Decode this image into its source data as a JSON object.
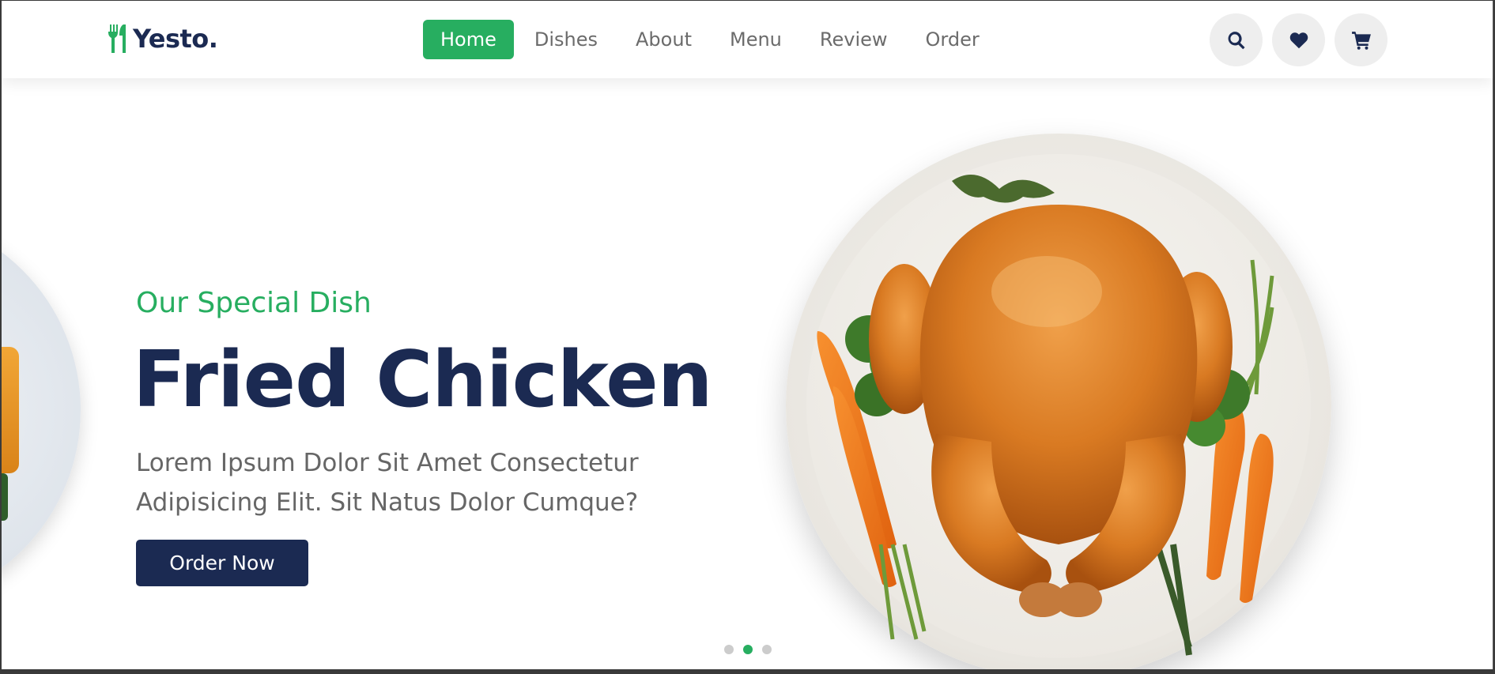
{
  "brand": {
    "name": "Yesto.",
    "accent_color": "#27ae60",
    "dark_color": "#1b2a52"
  },
  "nav": {
    "items": [
      {
        "label": "Home",
        "active": true
      },
      {
        "label": "Dishes",
        "active": false
      },
      {
        "label": "About",
        "active": false
      },
      {
        "label": "Menu",
        "active": false
      },
      {
        "label": "Review",
        "active": false
      },
      {
        "label": "Order",
        "active": false
      }
    ]
  },
  "header_icons": [
    "search-icon",
    "heart-icon",
    "cart-icon"
  ],
  "hero": {
    "subtitle": "Our Special Dish",
    "title": "Fried Chicken",
    "description": "Lorem Ipsum Dolor Sit Amet Consectetur Adipisicing Elit. Sit Natus Dolor Cumque?",
    "button_label": "Order Now",
    "image": "roast-chicken-plate"
  },
  "slider": {
    "dots": 3,
    "active_index": 1
  }
}
